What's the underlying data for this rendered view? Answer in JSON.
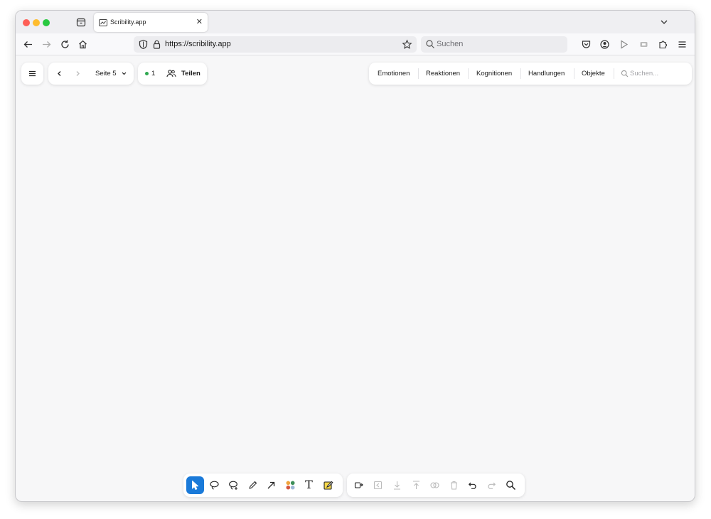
{
  "browser": {
    "tab": {
      "title": "Scribility.app"
    },
    "url": "https://scribility.app",
    "search_placeholder": "Suchen"
  },
  "app": {
    "page_label": "Seite 5",
    "online_count": "1",
    "share_label": "Teilen",
    "categories": [
      "Emotionen",
      "Reaktionen",
      "Kognitionen",
      "Handlungen",
      "Objekte"
    ],
    "search_placeholder": "Suchen..."
  },
  "colors": {
    "accent": "#1a7ad9",
    "online_dot": "#2fa84f",
    "canvas": "#f7f7f8"
  },
  "icons": {
    "draw_tools": [
      "select-cursor-icon",
      "lasso-icon",
      "lasso-add-icon",
      "pen-icon",
      "arrow-icon",
      "color-palette-icon",
      "text-icon",
      "sticky-note-icon"
    ],
    "edit_tools": [
      "duplicate-icon",
      "bring-to-front-icon",
      "move-down-icon",
      "move-up-icon",
      "group-icon",
      "delete-icon",
      "undo-icon",
      "redo-icon",
      "zoom-icon"
    ]
  }
}
